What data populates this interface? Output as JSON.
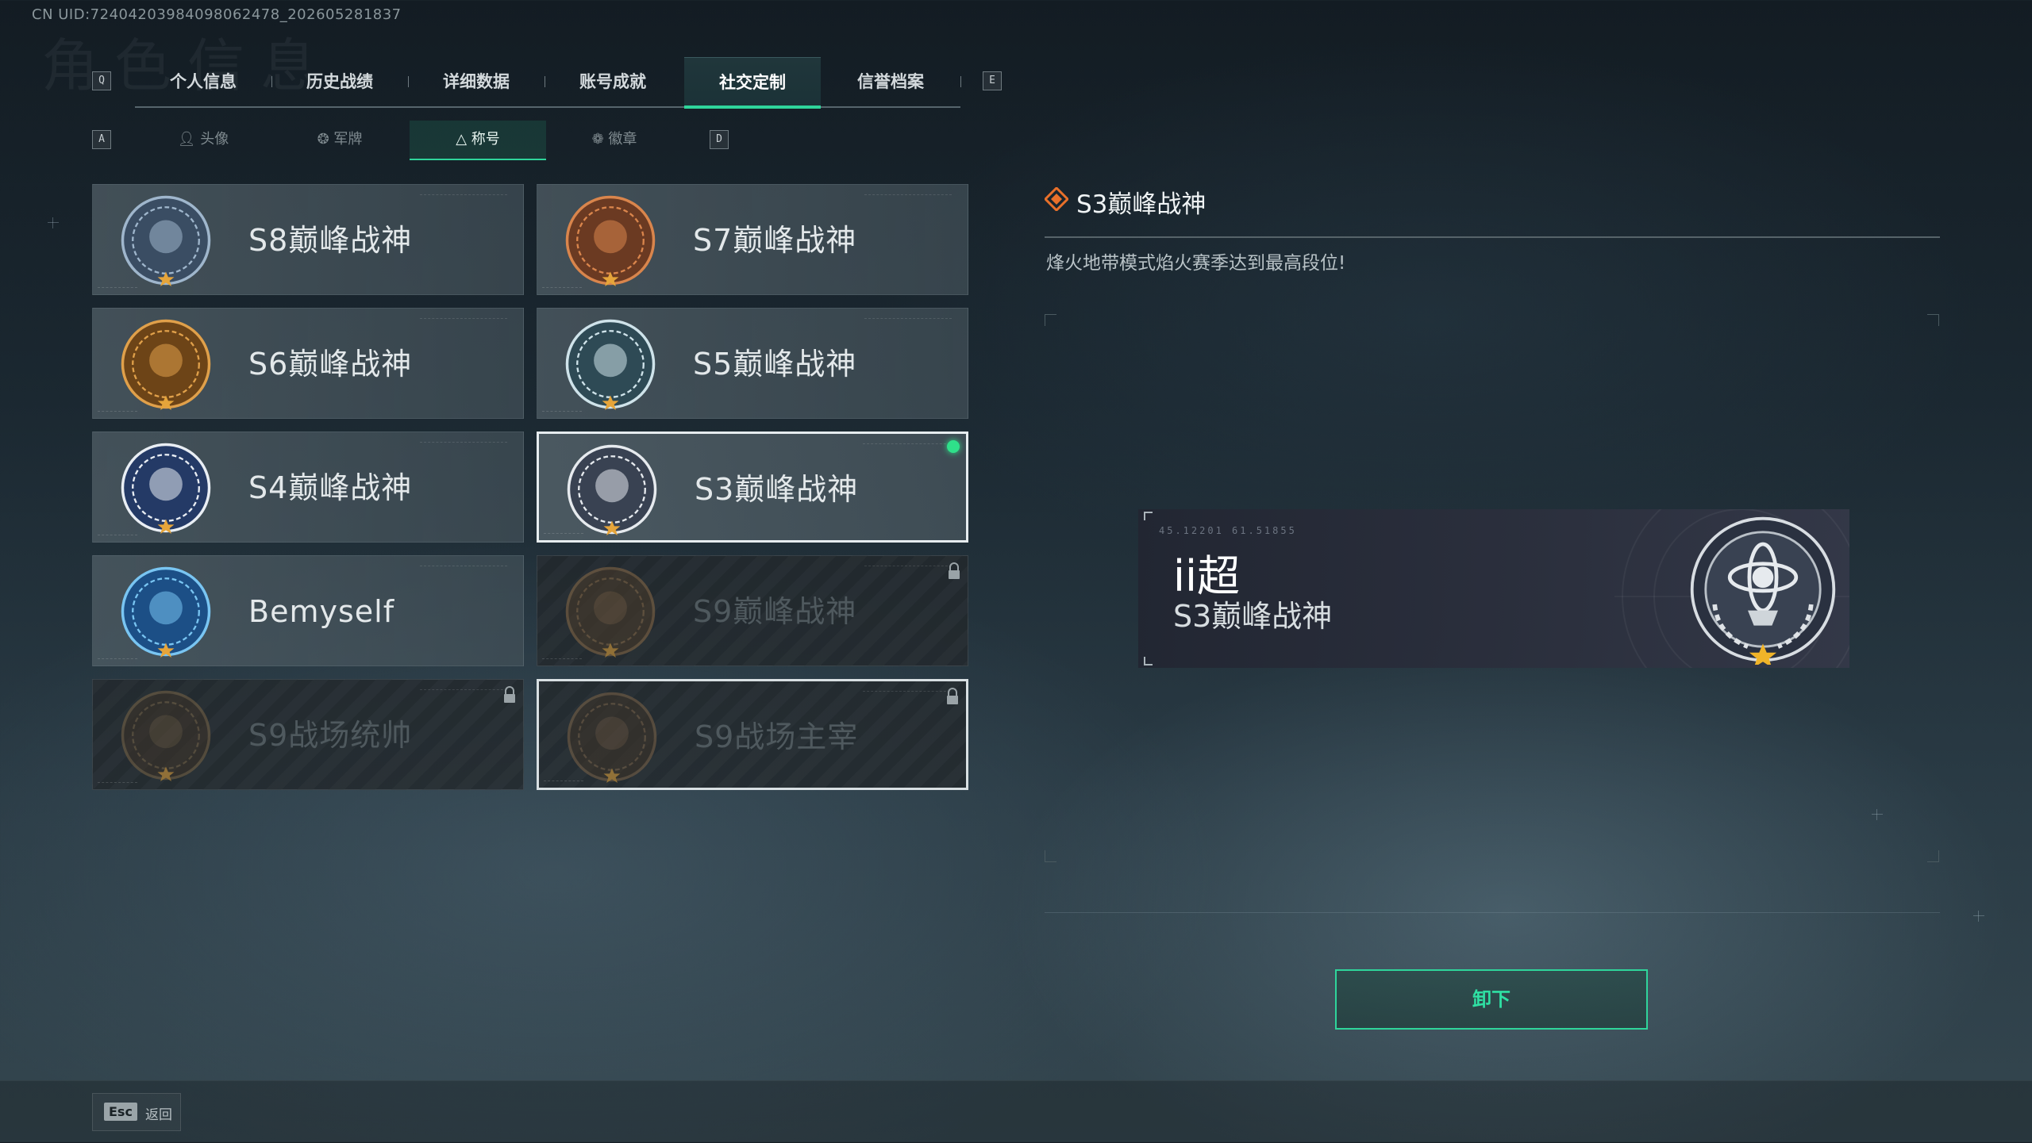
{
  "uid_text": "CN UID:7240420398409806247​8_202605281837",
  "ghost_title": "角色信息",
  "keys": {
    "prev_tab": "Q",
    "next_tab": "E",
    "prev_sub": "A",
    "next_sub": "D"
  },
  "tabs": [
    {
      "label": "个人信息",
      "active": false
    },
    {
      "label": "历史战绩",
      "active": false
    },
    {
      "label": "详细数据",
      "active": false
    },
    {
      "label": "账号成就",
      "active": false
    },
    {
      "label": "社交定制",
      "active": true
    },
    {
      "label": "信誉档案",
      "active": false
    }
  ],
  "subtabs": [
    {
      "label": "头像",
      "icon": "person-icon",
      "active": false
    },
    {
      "label": "军牌",
      "icon": "dogtag-icon",
      "active": false
    },
    {
      "label": "称号",
      "icon": "title-icon",
      "active": true
    },
    {
      "label": "徽章",
      "icon": "badge-icon",
      "active": false
    }
  ],
  "titles": [
    {
      "name": "S8巅峰战神",
      "state": "normal"
    },
    {
      "name": "S7巅峰战神",
      "state": "normal"
    },
    {
      "name": "S6巅峰战神",
      "state": "normal"
    },
    {
      "name": "S5巅峰战神",
      "state": "normal"
    },
    {
      "name": "S4巅峰战神",
      "state": "normal"
    },
    {
      "name": "S3巅峰战神",
      "state": "selected-equipped"
    },
    {
      "name": "Bemyself",
      "state": "normal"
    },
    {
      "name": "S9巅峰战神",
      "state": "locked"
    },
    {
      "name": "S9战场统帅",
      "state": "locked"
    },
    {
      "name": "S9战场主宰",
      "state": "locked"
    }
  ],
  "detail": {
    "title": "S3巅峰战神",
    "description": "烽火地带模式焰火赛季达到最高段位!"
  },
  "preview": {
    "code": "45.12201  61.51855",
    "player_name": "ii超",
    "title": "S3巅峰战神"
  },
  "unequip_label": "卸下",
  "esc": {
    "key": "Esc",
    "label": "返回"
  },
  "colors": {
    "accent": "#2fd59b",
    "equipped_dot": "#2fe08a"
  }
}
